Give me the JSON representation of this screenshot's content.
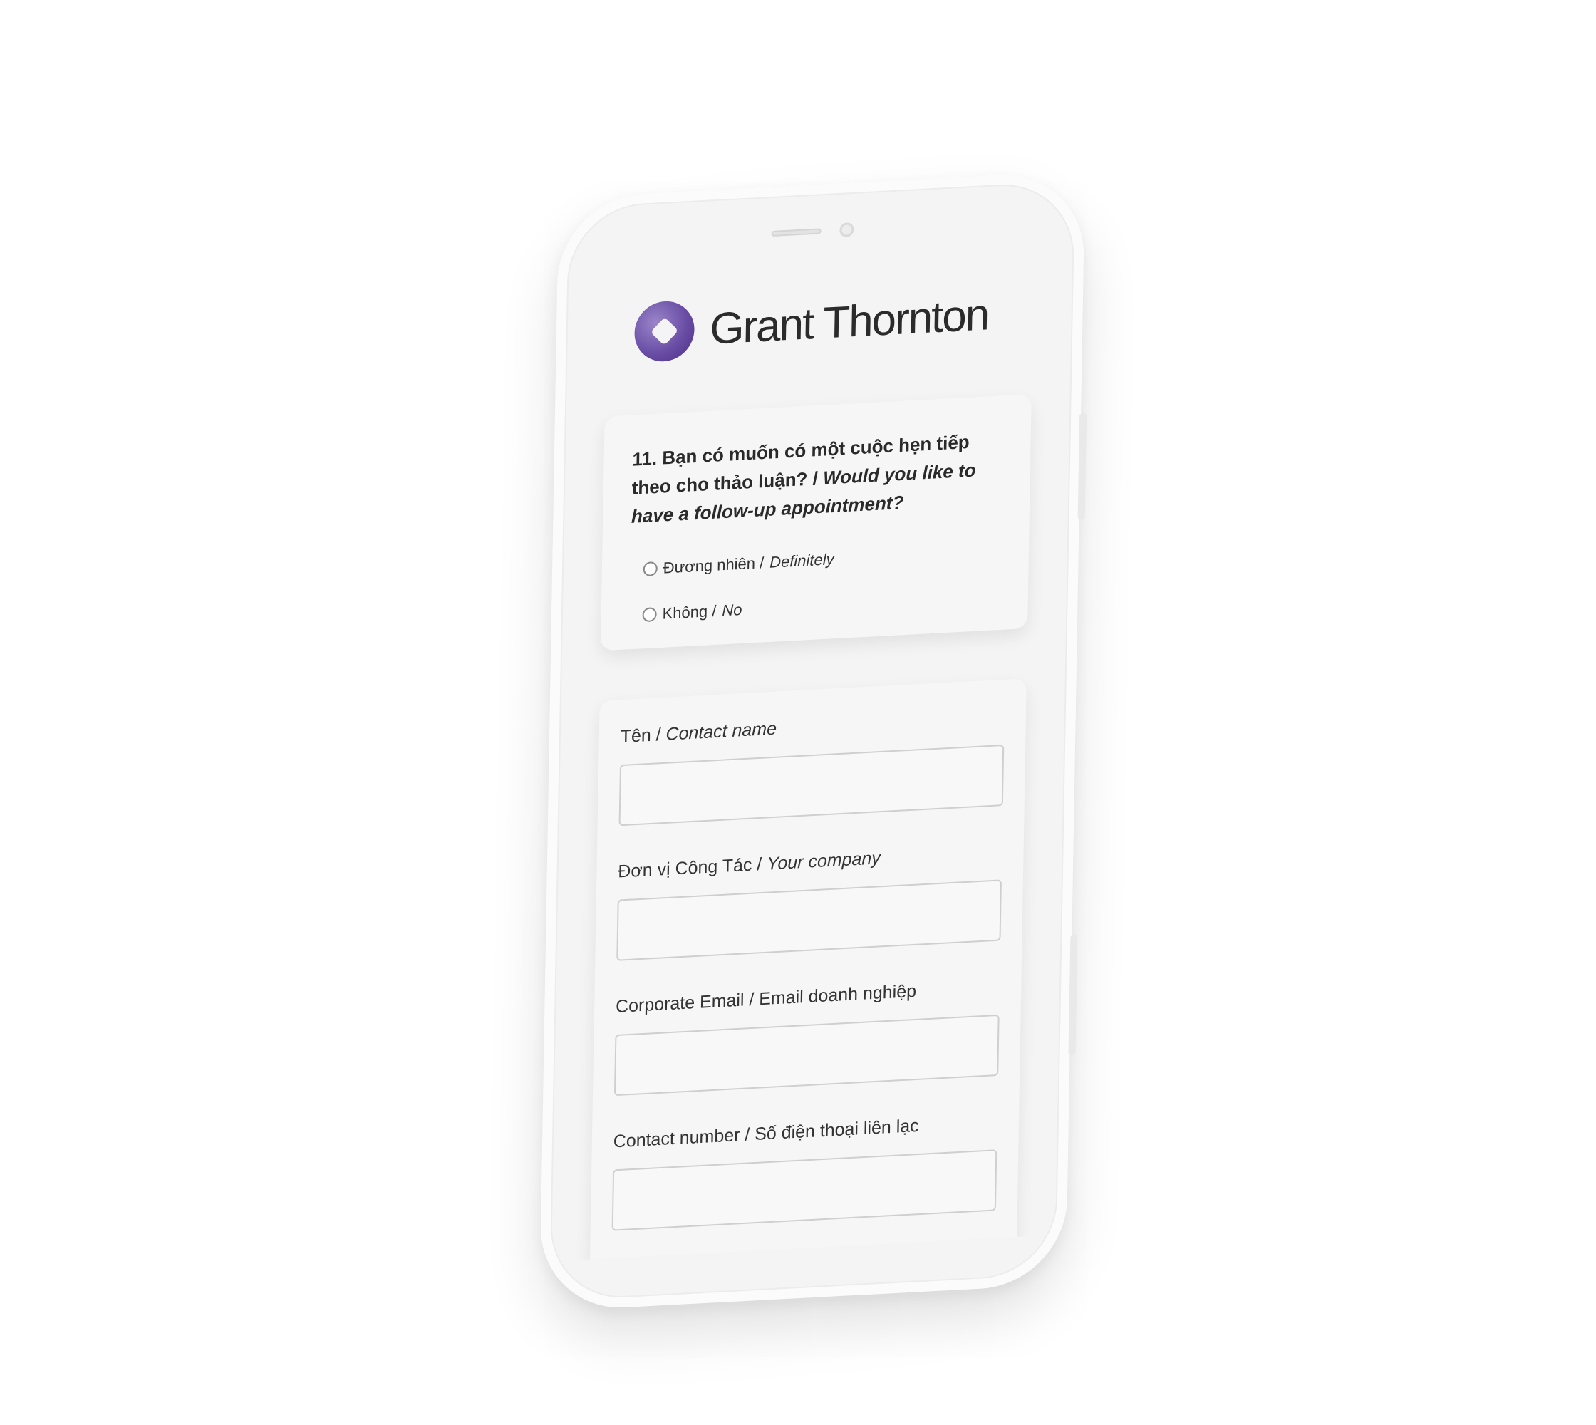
{
  "brand": {
    "name": "Grant Thornton"
  },
  "question": {
    "vi": "11. Bạn có muốn có một cuộc hẹn tiếp theo cho thảo luận? / ",
    "en": "Would you like to have a follow-up appointment?",
    "options": [
      {
        "vi": "Đương nhiên / ",
        "en": "Definitely"
      },
      {
        "vi": "Không / ",
        "en": "No"
      }
    ]
  },
  "form": {
    "fields": [
      {
        "vi": "Tên / ",
        "en": "Contact name",
        "value": ""
      },
      {
        "vi": "Đơn vị Công Tác / ",
        "en": "Your company",
        "value": ""
      },
      {
        "vi": "Corporate Email / Email doanh nghiệp",
        "en": "",
        "value": ""
      },
      {
        "vi": "Contact number / Số điện thoại liên lạc",
        "en": "",
        "value": ""
      }
    ]
  },
  "colors": {
    "brand_purple": "#6a4ea6",
    "device": "#f4f4f4",
    "card": "#f6f6f6"
  }
}
